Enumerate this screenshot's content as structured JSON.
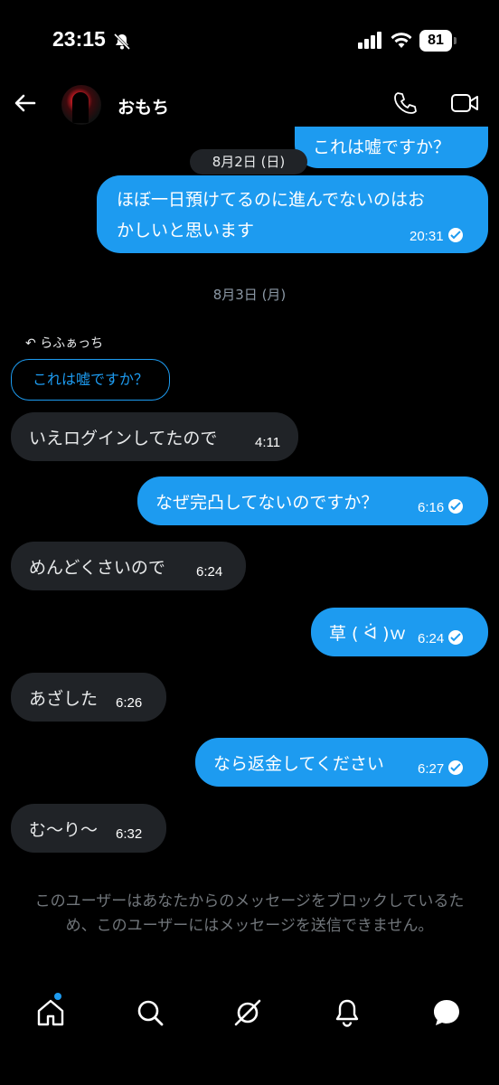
{
  "status_bar": {
    "time": "23:15",
    "battery": "81"
  },
  "header": {
    "contact_name": "おもち"
  },
  "messages": {
    "m0": {
      "text": "これは嘘ですか？"
    },
    "date1": "8月2日 (日)",
    "m1": {
      "line1": "ほぼ一日預けてるのに進んでないのはお",
      "line2": "かしいと思います",
      "time": "20:31"
    },
    "date2": "8月3日 (月)",
    "reply_to": "らふぁっち",
    "quoted": "これは嘘ですか？",
    "m2": {
      "text": "いえログインしてたので",
      "time": "4:11"
    },
    "m3": {
      "text": "なぜ完凸してないのですか？",
      "time": "6:16"
    },
    "m4": {
      "text": "めんどくさいので",
      "time": "6:24"
    },
    "m5": {
      "text": "草 ( ᐛ )ｗ",
      "time": "6:24"
    },
    "m6": {
      "text": "あざした",
      "time": "6:26"
    },
    "m7": {
      "text": "なら返金してください",
      "time": "6:27"
    },
    "m8": {
      "text": "む〜り〜",
      "time": "6:32"
    }
  },
  "notice": "このユーザーはあなたからのメッセージをブロックしているため、このユーザーにはメッセージを送信できません。",
  "tabs": [
    "home-icon",
    "search-icon",
    "grok-icon",
    "notifications-icon",
    "messages-icon"
  ],
  "colors": {
    "accent": "#1d9bf0",
    "incoming_bubble": "#202327",
    "background": "#000000"
  }
}
